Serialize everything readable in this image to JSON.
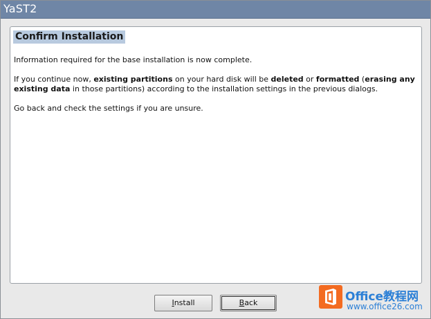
{
  "window": {
    "title": "YaST2"
  },
  "dialog": {
    "heading": "Confirm Installation",
    "paragraph1": "Information required for the base installation is now complete.",
    "paragraph2": {
      "t1": "If you continue now, ",
      "b1": "existing partitions",
      "t2": " on your hard disk will be ",
      "b2": "deleted",
      "t3": " or ",
      "b3": "formatted",
      "t4": " (",
      "b4": "erasing any existing data",
      "t5": " in those partitions) according to the installation settings in the previous dialogs."
    },
    "paragraph3": "Go back and check the settings if you are unsure."
  },
  "buttons": {
    "install": {
      "mnemonic": "I",
      "rest": "nstall"
    },
    "back": {
      "mnemonic": "B",
      "rest": "ack"
    }
  },
  "watermark": {
    "title": "Office教程网",
    "url": "www.office26.com"
  },
  "colors": {
    "titlebar": "#6f86a6",
    "heading_highlight": "#b8cadf",
    "watermark_blue": "#2b7fd6",
    "watermark_orange": "#f36b21"
  },
  "icons": {
    "watermark_logo": "office-logo-icon"
  }
}
